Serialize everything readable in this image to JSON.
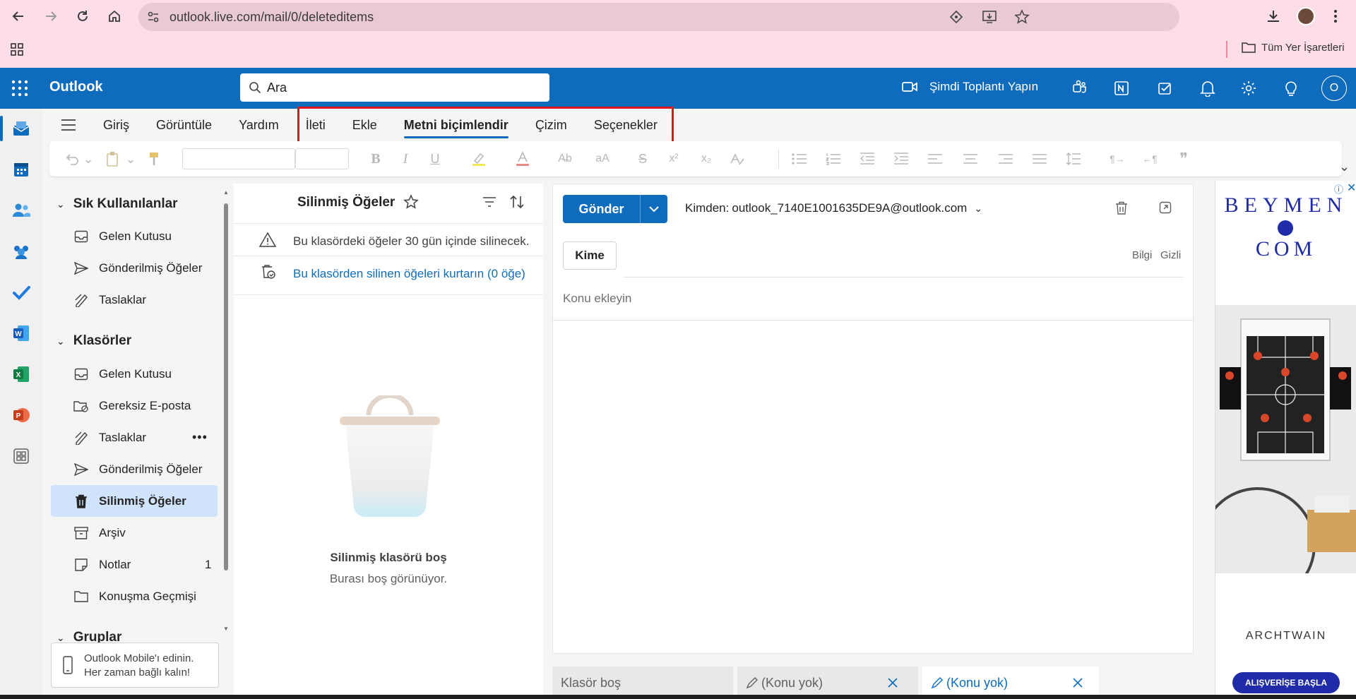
{
  "browser": {
    "url": "outlook.live.com/mail/0/deleteditems",
    "bookmarks_label": "Tüm Yer İşaretleri"
  },
  "header": {
    "app_name": "Outlook",
    "search_placeholder": "Ara",
    "meet_now": "Şimdi Toplantı Yapın",
    "account_initial": "O"
  },
  "tabs": [
    {
      "label": "Giriş"
    },
    {
      "label": "Görüntüle"
    },
    {
      "label": "Yardım"
    },
    {
      "label": "İleti"
    },
    {
      "label": "Ekle"
    },
    {
      "label": "Metni biçimlendir",
      "active": true
    },
    {
      "label": "Çizim"
    },
    {
      "label": "Seçenekler"
    }
  ],
  "folders": {
    "favorites_title": "Sık Kullanılanlar",
    "favorites": [
      {
        "label": "Gelen Kutusu",
        "icon": "inbox-icon"
      },
      {
        "label": "Gönderilmiş Öğeler",
        "icon": "send-icon"
      },
      {
        "label": "Taslaklar",
        "icon": "draft-icon"
      }
    ],
    "folders_title": "Klasörler",
    "items": [
      {
        "label": "Gelen Kutusu",
        "icon": "inbox-icon",
        "count": ""
      },
      {
        "label": "Gereksiz E-posta",
        "icon": "junk-icon",
        "count": ""
      },
      {
        "label": "Taslaklar",
        "icon": "draft-icon",
        "count": ""
      },
      {
        "label": "Gönderilmiş Öğeler",
        "icon": "send-icon",
        "count": ""
      },
      {
        "label": "Silinmiş Öğeler",
        "icon": "trash-icon",
        "count": "",
        "selected": true
      },
      {
        "label": "Arşiv",
        "icon": "archive-icon",
        "count": ""
      },
      {
        "label": "Notlar",
        "icon": "note-icon",
        "count": "1"
      },
      {
        "label": "Konuşma Geçmişi",
        "icon": "folder-icon",
        "count": ""
      }
    ],
    "groups_title": "Gruplar",
    "mobile_line1": "Outlook Mobile'ı edinin.",
    "mobile_line2": "Her zaman bağlı kalın!"
  },
  "list": {
    "title": "Silinmiş Öğeler",
    "warning": "Bu klasördeki öğeler 30 gün içinde silinecek.",
    "recover_link": "Bu klasörden silinen öğeleri kurtarın (0 öğe)",
    "empty_title": "Silinmiş klasörü boş",
    "empty_sub": "Burası boş görünüyor."
  },
  "compose": {
    "send": "Gönder",
    "from_label": "Kimden:",
    "from_address": "outlook_7140E1001635DE9A@outlook.com",
    "to_button": "Kime",
    "cc": "Bilgi",
    "bcc": "Gizli",
    "subject_placeholder": "Konu ekleyin"
  },
  "ad": {
    "brand_top": "BEYMEN",
    "brand_bottom": "COM",
    "caption": "ARCHTWAIN",
    "cta": "ALIŞVERİŞE BAŞLA"
  },
  "bottom_tabs": {
    "empty_folder": "Klasör boş",
    "draft1": "(Konu yok)",
    "draft2": "(Konu yok)"
  },
  "colors": {
    "brand": "#0f6cbd",
    "highlight": "#e0151e",
    "selected_folder": "#cfe4fa"
  }
}
